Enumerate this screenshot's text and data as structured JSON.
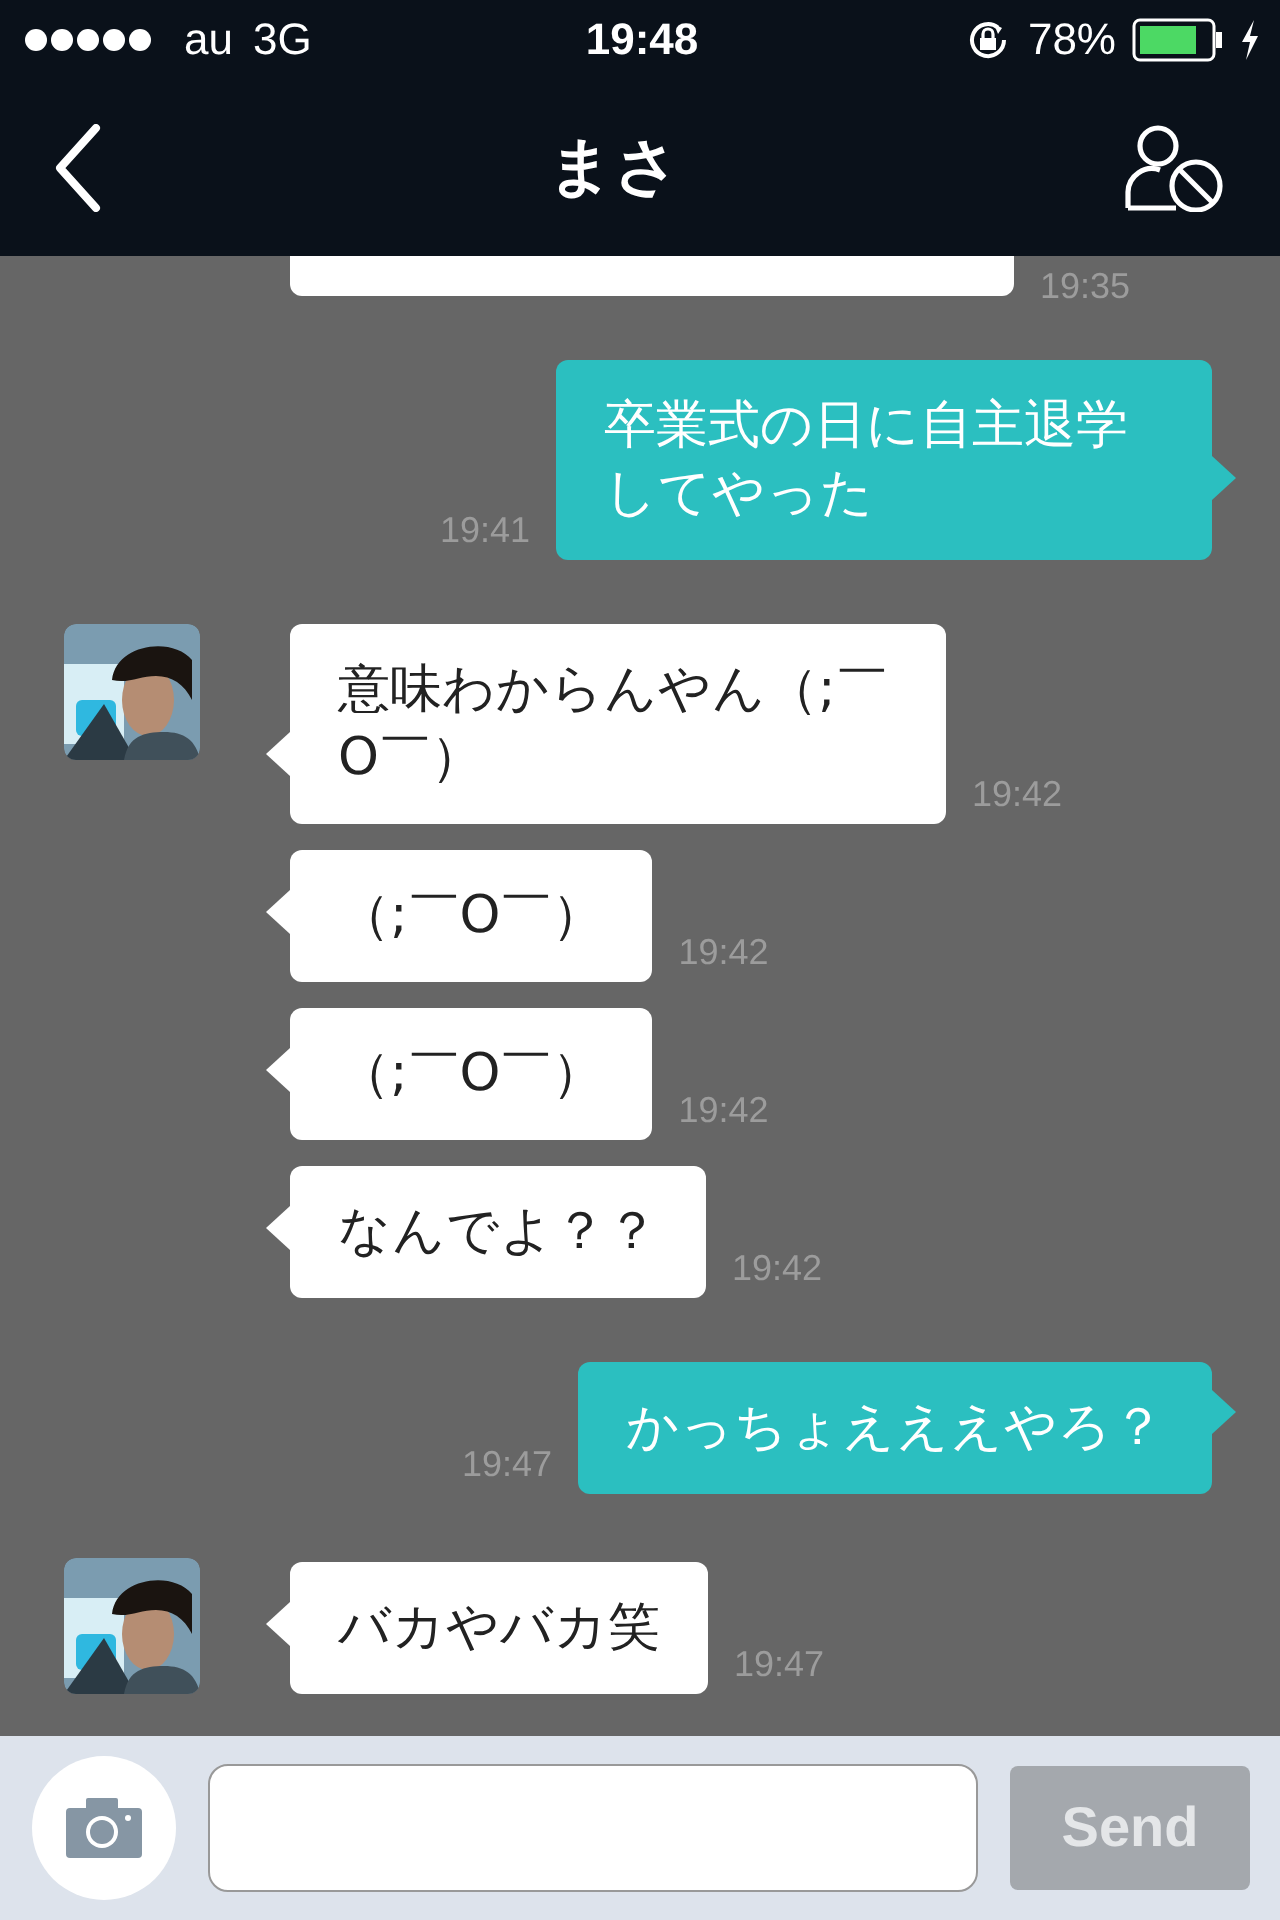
{
  "status_bar": {
    "carrier": "au",
    "network": "3G",
    "time": "19:48",
    "battery": "78%"
  },
  "header": {
    "title": "まさ"
  },
  "messages": [
    {
      "kind": "clipped",
      "time": "19:35",
      "avatar": false
    },
    {
      "kind": "outgoing",
      "text": "卒業式の日に自主退学してやった",
      "time": "19:41",
      "avatar": false
    },
    {
      "kind": "incoming",
      "text": "意味わからんやん（;￣O￣）",
      "time": "19:42",
      "avatar": true
    },
    {
      "kind": "incoming",
      "text": "（;￣O￣）",
      "time": "19:42",
      "avatar": false
    },
    {
      "kind": "incoming",
      "text": "（;￣O￣）",
      "time": "19:42",
      "avatar": false
    },
    {
      "kind": "incoming",
      "text": "なんでよ？？",
      "time": "19:42",
      "avatar": false
    },
    {
      "kind": "outgoing",
      "text": "かっちょえええやろ？",
      "time": "19:47",
      "avatar": false
    },
    {
      "kind": "incoming",
      "text": "バカやバカ笑",
      "time": "19:47",
      "avatar": true
    }
  ],
  "composer": {
    "send_button": {
      "label": "Send",
      "disabled": true
    }
  }
}
